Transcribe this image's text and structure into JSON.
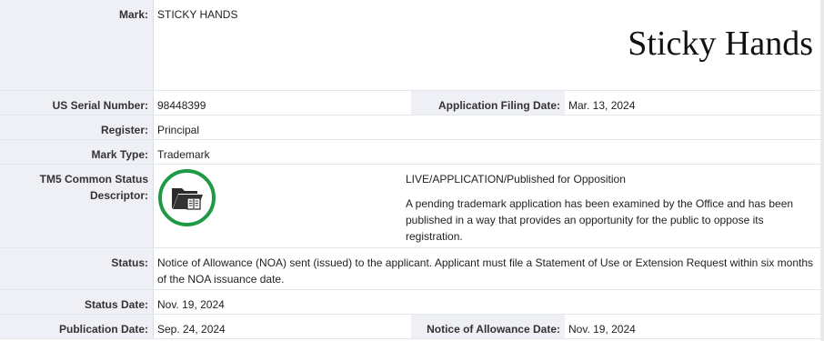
{
  "mark": {
    "label": "Mark:",
    "value": "STICKY HANDS",
    "image_text": "Sticky Hands"
  },
  "serial": {
    "label": "US Serial Number:",
    "value": "98448399"
  },
  "filing": {
    "label": "Application Filing Date:",
    "value": "Mar. 13, 2024"
  },
  "register": {
    "label": "Register:",
    "value": "Principal"
  },
  "mark_type": {
    "label": "Mark Type:",
    "value": "Trademark"
  },
  "tm5": {
    "label_line1": "TM5 Common Status",
    "label_line2": "Descriptor:",
    "icon": "folder-document-icon",
    "status": "LIVE/APPLICATION/Published for Opposition",
    "description": "A pending trademark application has been examined by the Office and has been published in a way that provides an opportunity for the public to oppose its registration."
  },
  "status": {
    "label": "Status:",
    "value": "Notice of Allowance (NOA) sent (issued) to the applicant. Applicant must file a Statement of Use or Extension Request within six months of the NOA issuance date."
  },
  "status_date": {
    "label": "Status Date:",
    "value": "Nov. 19, 2024"
  },
  "publication": {
    "label": "Publication Date:",
    "value": "Sep. 24, 2024"
  },
  "noa": {
    "label": "Notice of Allowance Date:",
    "value": "Nov. 19, 2024"
  },
  "colors": {
    "label_bg": "#eef0f5",
    "icon_ring": "#1e9a45"
  }
}
